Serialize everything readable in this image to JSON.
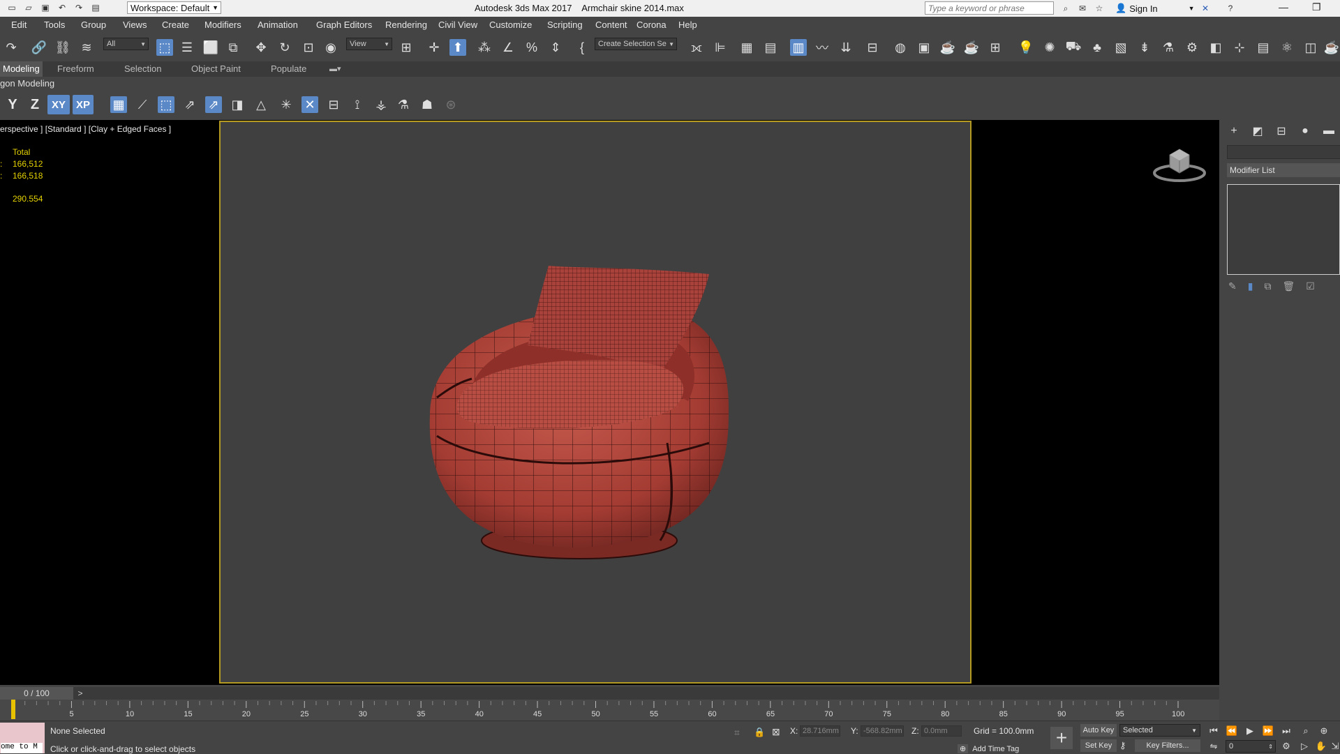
{
  "titlebar": {
    "workspace_label": "Workspace: Default",
    "app_title": "Autodesk 3ds Max 2017",
    "file_name": "Armchair skine  2014.max",
    "search_placeholder": "Type a keyword or phrase",
    "sign_in": "Sign In"
  },
  "menu": [
    "Edit",
    "Tools",
    "Group",
    "Views",
    "Create",
    "Modifiers",
    "Animation",
    "Graph Editors",
    "Rendering",
    "Civil View",
    "Customize",
    "Scripting",
    "Content",
    "Corona",
    "Help"
  ],
  "toolbar": {
    "selection_filter": "All",
    "ref_coord": "View",
    "selection_set": "Create Selection Se"
  },
  "ribbon": {
    "tabs": [
      "Modeling",
      "Freeform",
      "Selection",
      "Object Paint",
      "Populate"
    ],
    "panel_label": "gon Modeling"
  },
  "axis": {
    "y": "Y",
    "z": "Z",
    "xy": "XY",
    "xp": "XP"
  },
  "viewport": {
    "label": "erspective ] [Standard ] [Clay + Edged Faces ]",
    "stats_header": "Total",
    "stats_row1_prefix": ":",
    "stats_row1_value": "166,512",
    "stats_row2_prefix": ":",
    "stats_row2_value": "166,518",
    "fps_value": "290.554"
  },
  "command_panel": {
    "modifier_list": "Modifier List"
  },
  "timeline": {
    "frame_label": "0 / 100",
    "next": ">",
    "tick_labels": [
      "5",
      "10",
      "15",
      "20",
      "25",
      "30",
      "35",
      "40",
      "45",
      "50",
      "55",
      "60",
      "65",
      "70",
      "75",
      "80",
      "85",
      "90",
      "95",
      "100"
    ],
    "current_frame": 0
  },
  "statusbar": {
    "maxscript": "ome to M",
    "selection_status": "None Selected",
    "prompt": "Click or click-and-drag to select objects",
    "x_label": "X:",
    "x_value": "28.716mm",
    "y_label": "Y:",
    "y_value": "-568.82mm",
    "z_label": "Z:",
    "z_value": "0.0mm",
    "grid": "Grid = 100.0mm",
    "add_time_tag": "Add Time Tag",
    "auto_key": "Auto Key",
    "set_key": "Set Key",
    "key_mode": "Selected",
    "key_filters": "Key Filters...",
    "frame_field": "0"
  },
  "colors": {
    "accent": "#5b88c6",
    "model": "#b0463c",
    "safe_frame": "#b59a22",
    "stats": "#e5d300"
  }
}
